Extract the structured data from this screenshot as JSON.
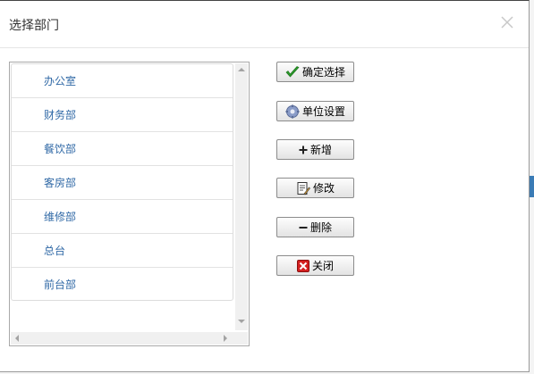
{
  "dialog": {
    "title": "选择部门"
  },
  "departments": [
    {
      "label": "办公室"
    },
    {
      "label": "财务部"
    },
    {
      "label": "餐饮部"
    },
    {
      "label": "客房部"
    },
    {
      "label": "维修部"
    },
    {
      "label": "总台"
    },
    {
      "label": "前台部"
    }
  ],
  "buttons": {
    "confirm": {
      "label": "确定选择",
      "icon": "check-icon"
    },
    "unit_settings": {
      "label": "单位设置",
      "icon": "gear-icon"
    },
    "add": {
      "label": "新增",
      "icon": "plus-icon"
    },
    "edit": {
      "label": "修改",
      "icon": "edit-document-icon"
    },
    "delete": {
      "label": "删除",
      "icon": "minus-icon"
    },
    "close": {
      "label": "关闭",
      "icon": "close-x-icon"
    }
  },
  "colors": {
    "link": "#3069a6",
    "confirm_check": "#2a9a2a",
    "close_red": "#d42020"
  }
}
